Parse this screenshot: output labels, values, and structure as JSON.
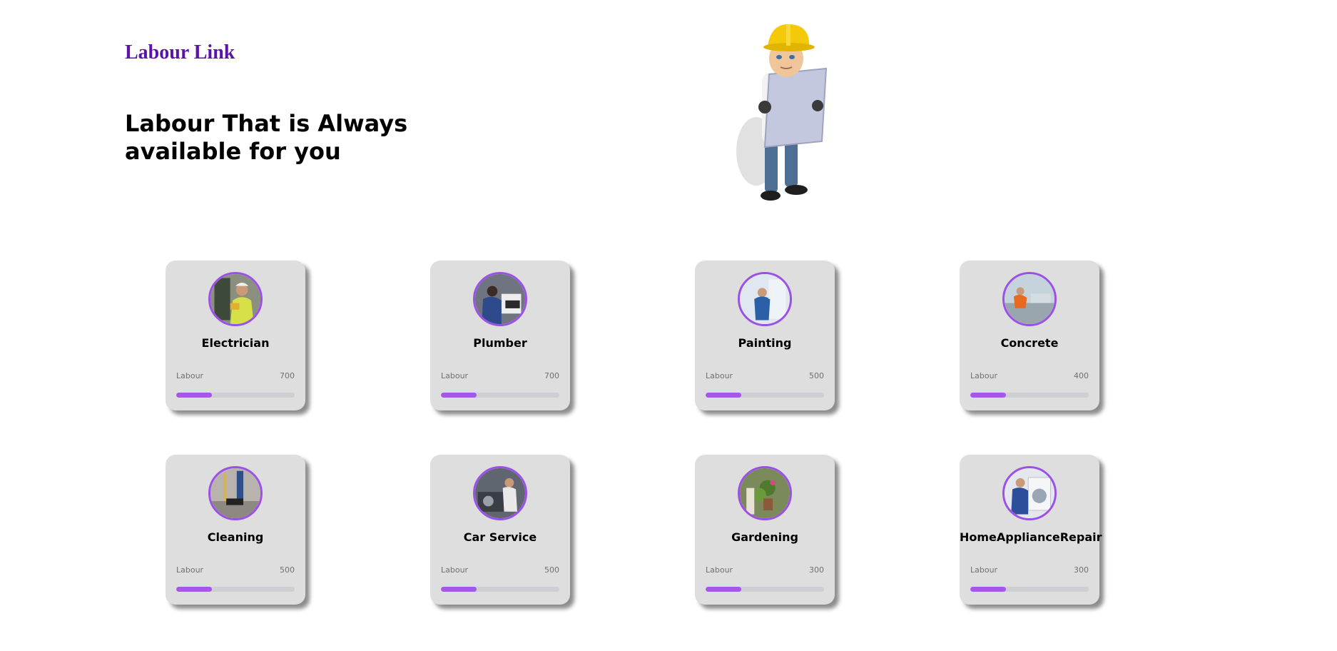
{
  "brand": "Labour Link",
  "headline": "Labour That is Always available for you",
  "mascot_icon": "construction-worker-with-blueprint",
  "accent_color": "#9b50e6",
  "brand_color": "#5b14a8",
  "cards": [
    {
      "title": "Electrician",
      "label": "Labour",
      "value": "700",
      "progress": 0.3,
      "icon": "electrician-photo"
    },
    {
      "title": "Plumber",
      "label": "Labour",
      "value": "700",
      "progress": 0.3,
      "icon": "plumber-photo"
    },
    {
      "title": "Painting",
      "label": "Labour",
      "value": "500",
      "progress": 0.3,
      "icon": "painter-photo"
    },
    {
      "title": "Concrete",
      "label": "Labour",
      "value": "400",
      "progress": 0.3,
      "icon": "concrete-photo"
    },
    {
      "title": "Cleaning",
      "label": "Labour",
      "value": "500",
      "progress": 0.3,
      "icon": "cleaning-photo"
    },
    {
      "title": "Car Service",
      "label": "Labour",
      "value": "500",
      "progress": 0.3,
      "icon": "car-service-photo"
    },
    {
      "title": "Gardening",
      "label": "Labour",
      "value": "300",
      "progress": 0.3,
      "icon": "gardening-photo"
    },
    {
      "title": "HomeApplianceRepair",
      "label": "Labour",
      "value": "300",
      "progress": 0.3,
      "icon": "appliance-repair-photo"
    }
  ]
}
